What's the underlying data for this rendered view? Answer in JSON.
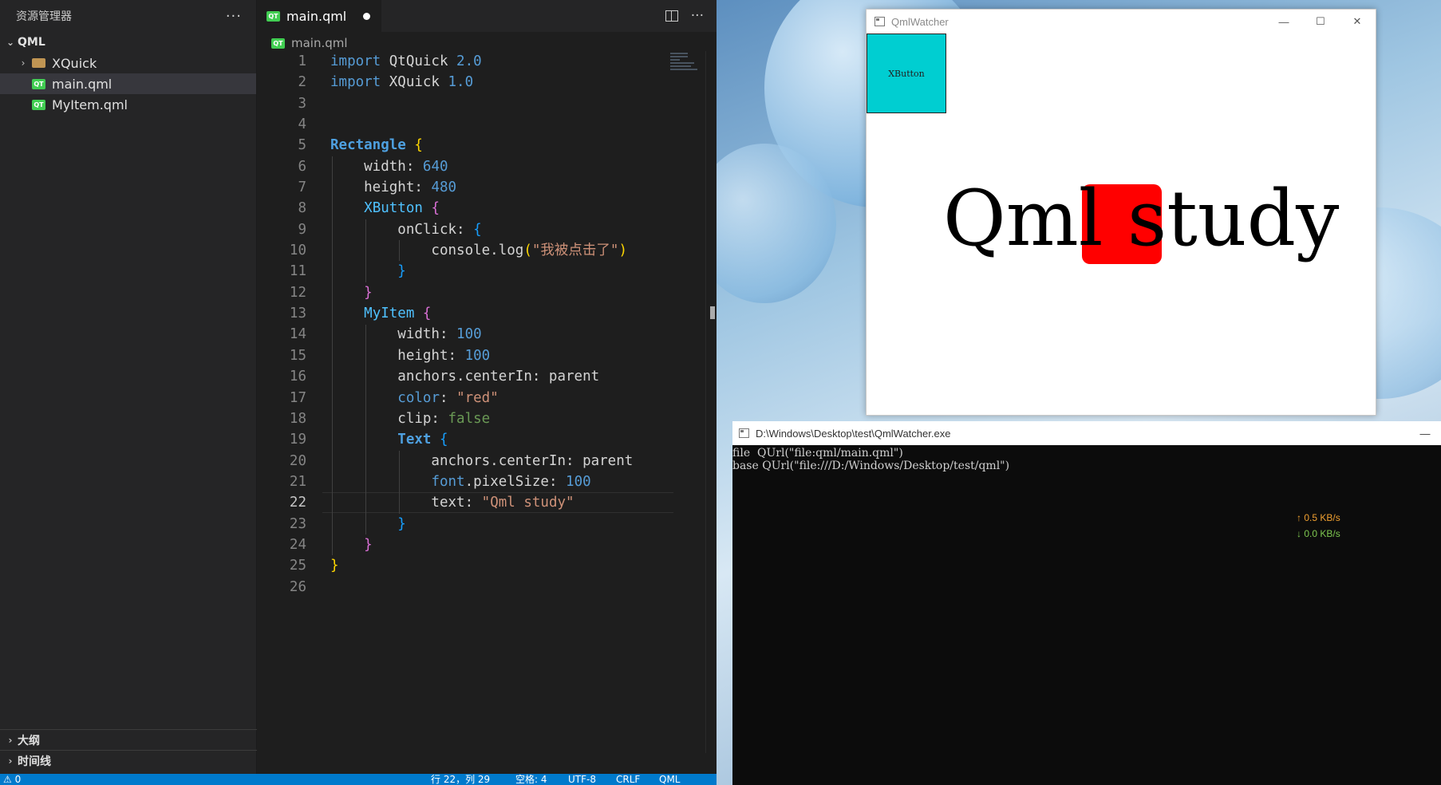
{
  "explorer": {
    "title": "资源管理器",
    "more": "···",
    "root": "QML",
    "items": [
      {
        "label": "XQuick",
        "kind": "folder"
      },
      {
        "label": "main.qml",
        "kind": "qml",
        "selected": true
      },
      {
        "label": "MyItem.qml",
        "kind": "qml"
      }
    ],
    "outline": "大纲",
    "timeline": "时间线"
  },
  "editor": {
    "tab_label": "main.qml",
    "tab_icon": "QT",
    "breadcrumb": "main.qml",
    "more": "···",
    "current_line": 22
  },
  "code_lines": [
    "import QtQuick 2.0",
    "import XQuick 1.0",
    "",
    "",
    "Rectangle {",
    "    width: 640",
    "    height: 480",
    "    XButton {",
    "        onClick: {",
    "            console.log(\"我被点击了\")",
    "        }",
    "    }",
    "    MyItem {",
    "        width: 100",
    "        height: 100",
    "        anchors.centerIn: parent",
    "        color: \"red\"",
    "        clip: false",
    "        Text {",
    "            anchors.centerIn: parent",
    "            font.pixelSize: 100",
    "            text: \"Qml study\"",
    "        }",
    "    }",
    "}",
    ""
  ],
  "status": {
    "left": "⚠ 0",
    "line_col": "行 22，列 29",
    "spaces": "空格: 4",
    "encoding": "UTF-8",
    "eol": "CRLF",
    "language": "QML"
  },
  "qml_window": {
    "title": "QmlWatcher",
    "button_label": "XButton",
    "text": "Qml study"
  },
  "console": {
    "title": "D:\\Windows\\Desktop\\test\\QmlWatcher.exe",
    "lines": [
      "file  QUrl(\"file:qml/main.qml\")",
      "base QUrl(\"file:///D:/Windows/Desktop/test/qml\")"
    ]
  },
  "network": {
    "up": "↑ 0.5 KB/s",
    "down": "↓ 0.0 KB/s",
    "up_color": "#f0a030",
    "down_color": "#7ec850"
  },
  "colors": {
    "accent": "#007acc",
    "button_fill": "#00ced1",
    "item_fill": "#ff0000"
  }
}
